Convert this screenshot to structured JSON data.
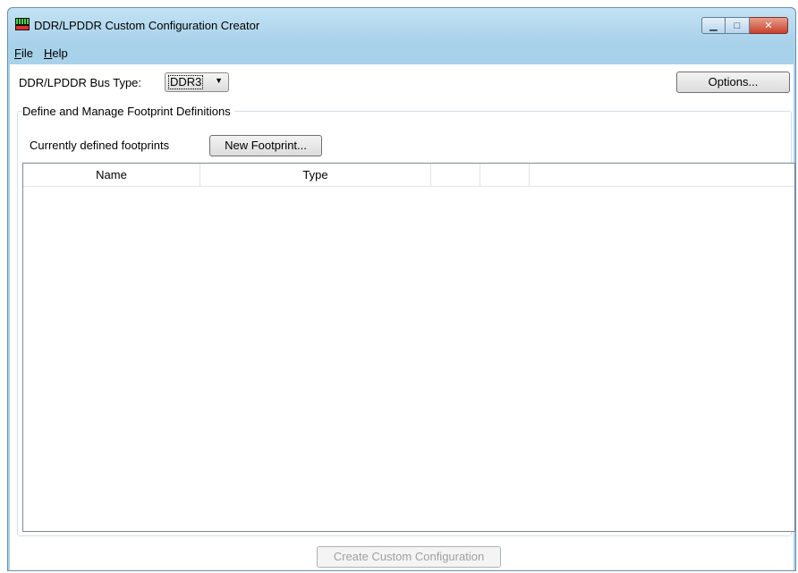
{
  "window": {
    "title": "DDR/LPDDR Custom Configuration Creator",
    "minimize_glyph": "▁",
    "maximize_glyph": "□",
    "close_glyph": "✕"
  },
  "menu": {
    "file_hotkey": "F",
    "file_rest": "ile",
    "help_hotkey": "H",
    "help_rest": "elp"
  },
  "bus": {
    "label": "DDR/LPDDR Bus Type:",
    "value": "DDR3",
    "arrow": "▼"
  },
  "options_button": "Options...",
  "group": {
    "title": "Define and Manage Footprint Definitions",
    "footprints_label": "Currently defined footprints",
    "new_button": "New Footprint..."
  },
  "table": {
    "columns": [
      "Name",
      "Type",
      "",
      ""
    ],
    "rows": []
  },
  "create_button": "Create Custom Configuration"
}
